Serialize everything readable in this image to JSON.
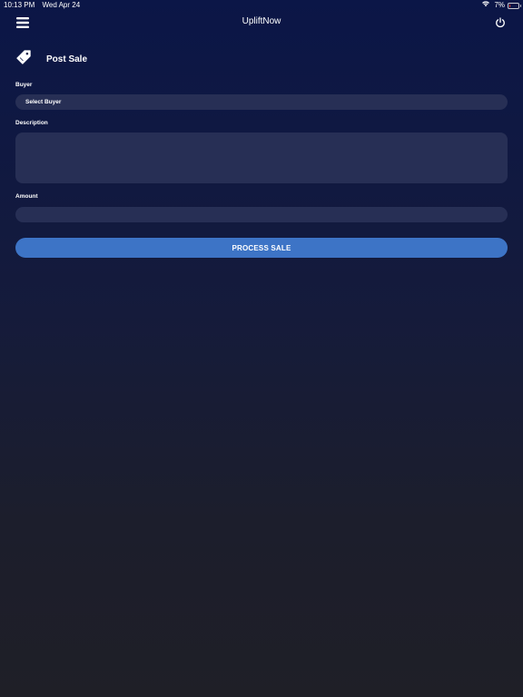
{
  "status_bar": {
    "time": "10:13 PM",
    "date": "Wed Apr 24",
    "battery_percent": "7%",
    "battery_level": 0.07,
    "wifi_icon": "wifi-icon",
    "battery_icon": "battery-icon",
    "battery_color": "#ff3b30"
  },
  "nav": {
    "title": "UpliftNow",
    "menu_icon": "hamburger-menu-icon",
    "power_icon": "power-icon"
  },
  "page": {
    "title": "Post Sale",
    "icon": "price-tag-icon"
  },
  "form": {
    "buyer": {
      "label": "Buyer",
      "value": "Select Buyer"
    },
    "description": {
      "label": "Description",
      "value": ""
    },
    "amount": {
      "label": "Amount",
      "value": ""
    },
    "submit_label": "PROCESS SALE"
  },
  "colors": {
    "background_top": "#0b1647",
    "background_bottom": "#1f1f27",
    "field_background": "#272f55",
    "accent": "#3d74c6"
  }
}
